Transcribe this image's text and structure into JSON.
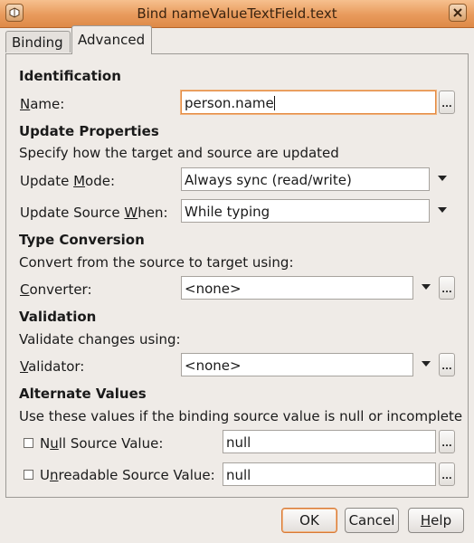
{
  "window": {
    "title": "Bind nameValueTextField.text"
  },
  "tabs": [
    {
      "label": "Binding",
      "active": false
    },
    {
      "label": "Advanced",
      "active": true
    }
  ],
  "identification": {
    "header": "Identification",
    "name_label": "Name:",
    "name_value": "person.name"
  },
  "update": {
    "header": "Update Properties",
    "description": "Specify how the target and source are updated",
    "mode_label": "Update Mode:",
    "mode_value": "Always sync (read/write)",
    "when_label": "Update Source When:",
    "when_value": "While typing"
  },
  "conversion": {
    "header": "Type Conversion",
    "description": "Convert from the source to target using:",
    "converter_label": "Converter:",
    "converter_value": "<none>"
  },
  "validation": {
    "header": "Validation",
    "description": "Validate changes using:",
    "validator_label": "Validator:",
    "validator_value": "<none>"
  },
  "alternate": {
    "header": "Alternate Values",
    "description": "Use these values if the binding source value is null or incomplete",
    "null_label": "Null Source Value:",
    "null_value": "null",
    "null_checked": false,
    "unreadable_label": "Unreadable Source Value:",
    "unreadable_value": "null",
    "unreadable_checked": false
  },
  "ellipsis": "...",
  "buttons": {
    "ok": "OK",
    "cancel": "Cancel",
    "help": "Help"
  },
  "colors": {
    "titlebar": "#e89a5c",
    "focus": "#e48a41"
  }
}
